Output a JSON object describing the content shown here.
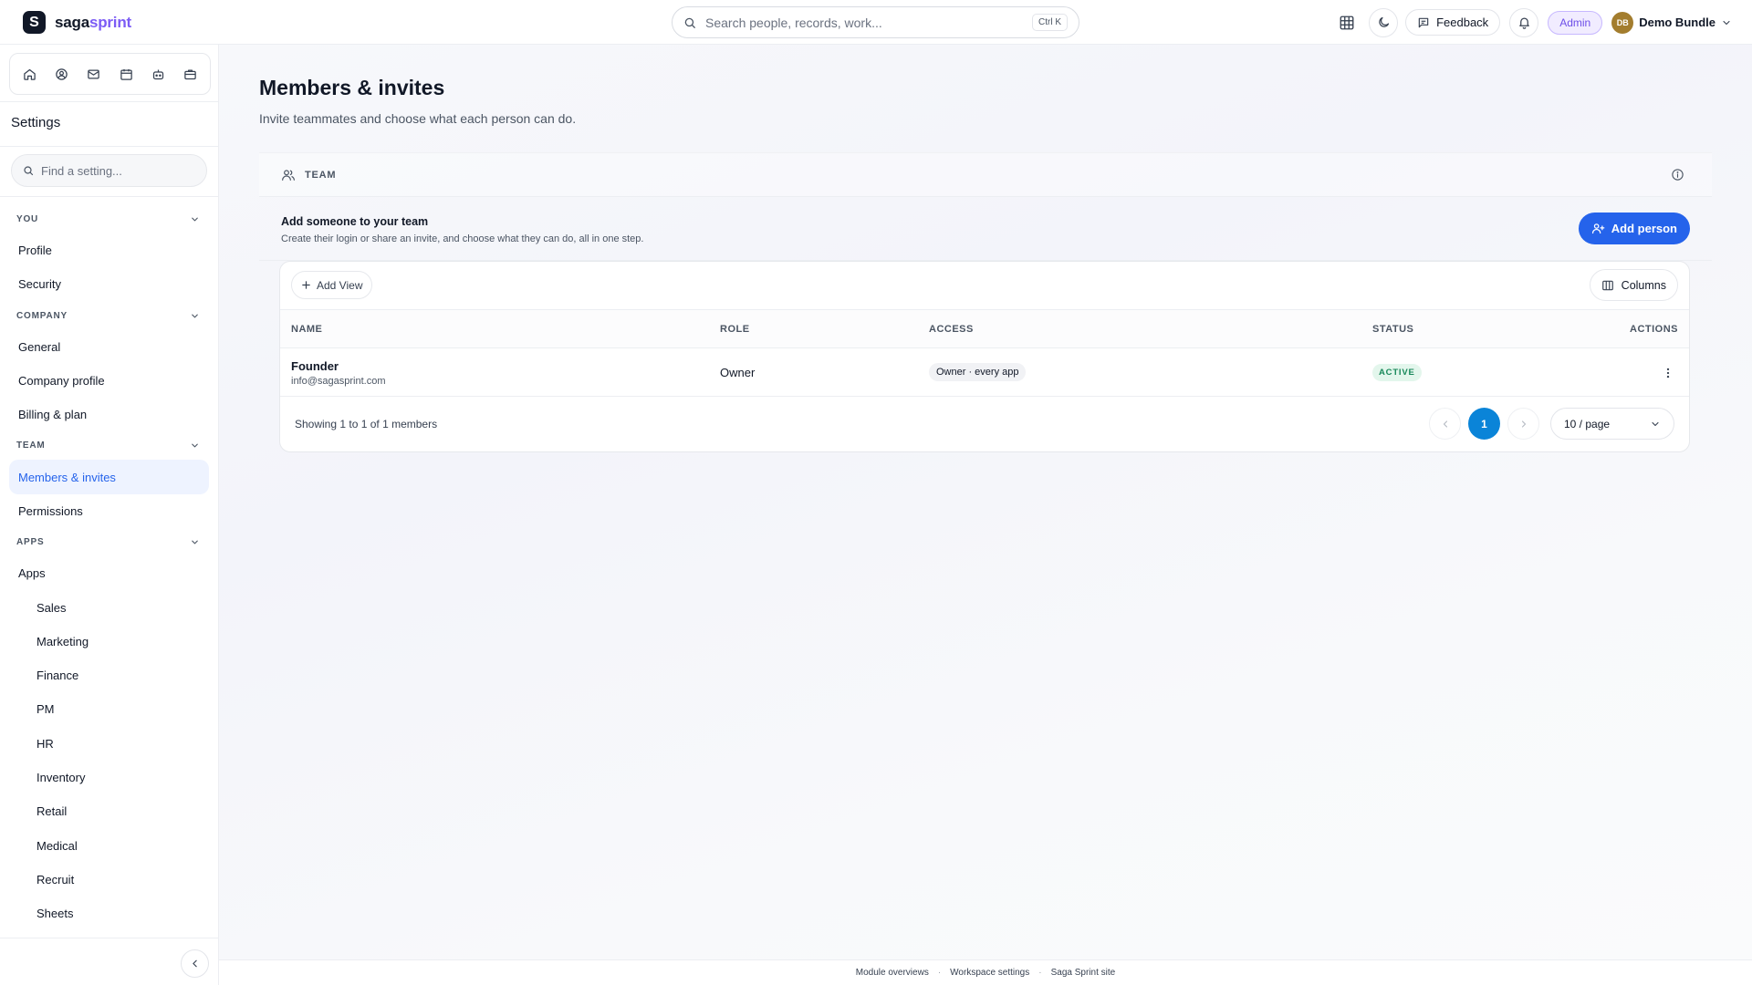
{
  "brand": {
    "mark": "S",
    "name_part1": "saga",
    "name_part2": "sprint"
  },
  "topbar": {
    "search_placeholder": "Search people, records, work...",
    "search_shortcut": "Ctrl K",
    "feedback_label": "Feedback",
    "role_badge": "Admin",
    "user_initials": "DB",
    "user_name": "Demo Bundle"
  },
  "sidebar": {
    "title": "Settings",
    "search_placeholder": "Find a setting...",
    "sections": [
      {
        "label": "YOU",
        "items": [
          {
            "label": "Profile"
          },
          {
            "label": "Security"
          }
        ]
      },
      {
        "label": "COMPANY",
        "items": [
          {
            "label": "General"
          },
          {
            "label": "Company profile"
          },
          {
            "label": "Billing & plan"
          }
        ]
      },
      {
        "label": "TEAM",
        "items": [
          {
            "label": "Members & invites"
          },
          {
            "label": "Permissions"
          }
        ]
      },
      {
        "label": "APPS",
        "items": [
          {
            "label": "Apps"
          },
          {
            "label": "Sales"
          },
          {
            "label": "Marketing"
          },
          {
            "label": "Finance"
          },
          {
            "label": "PM"
          },
          {
            "label": "HR"
          },
          {
            "label": "Inventory"
          },
          {
            "label": "Retail"
          },
          {
            "label": "Medical"
          },
          {
            "label": "Recruit"
          },
          {
            "label": "Sheets"
          }
        ]
      }
    ]
  },
  "page": {
    "title": "Members & invites",
    "subtitle": "Invite teammates and choose what each person can do."
  },
  "team_card": {
    "header_label": "TEAM",
    "add_title": "Add someone to your team",
    "add_description": "Create their login or share an invite, and choose what they can do, all in one step.",
    "add_button": "Add person"
  },
  "table": {
    "add_view_label": "Add View",
    "columns_label": "Columns",
    "headers": {
      "name": "NAME",
      "role": "ROLE",
      "access": "ACCESS",
      "status": "STATUS",
      "actions": "ACTIONS"
    },
    "rows": [
      {
        "name": "Founder",
        "email": "info@sagasprint.com",
        "role": "Owner",
        "access": "Owner · every app",
        "status": "ACTIVE"
      }
    ],
    "showing_text": "Showing 1 to 1 of 1 members",
    "current_page": "1",
    "page_size": "10 / page"
  },
  "footer": {
    "links": [
      "Module overviews",
      "Workspace settings",
      "Saga Sprint site"
    ]
  },
  "colors": {
    "accent": "#2563eb",
    "brand_purple": "#7c5cf5",
    "pager_active": "#0a84d8",
    "status_active": "#18885a"
  },
  "icons": {
    "topbar": [
      "search-icon",
      "apps-grid-icon",
      "moon-icon",
      "feedback-icon",
      "bell-icon",
      "chevron-down-icon"
    ],
    "app_switcher": [
      "home-icon",
      "user-circle-icon",
      "mail-icon",
      "calendar-icon",
      "robot-icon",
      "briefcase-icon"
    ],
    "misc": [
      "users-icon",
      "info-icon",
      "user-plus-icon",
      "plus-icon",
      "columns-icon",
      "kebab-icon",
      "chevron-left-icon",
      "chevron-right-icon"
    ]
  }
}
